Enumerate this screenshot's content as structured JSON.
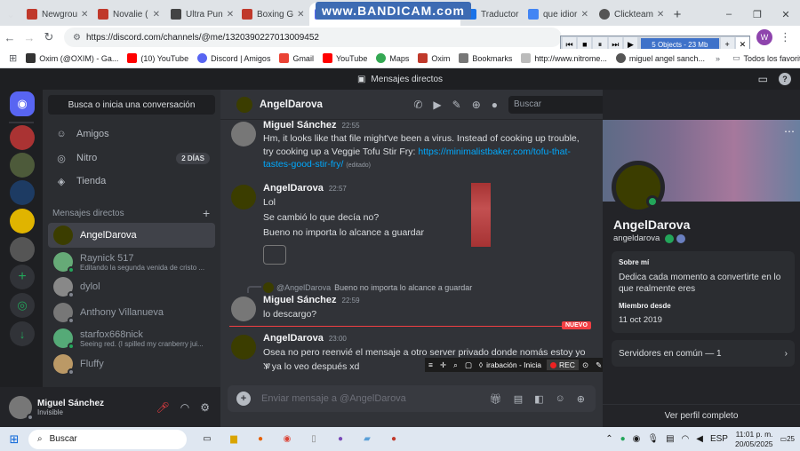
{
  "browser": {
    "tabs": [
      {
        "label": "Newgrou",
        "color": "#c0392b"
      },
      {
        "label": "Novalie (",
        "color": "#c0392b"
      },
      {
        "label": "Ultra Pun",
        "color": "#444"
      },
      {
        "label": "Boxing G",
        "color": "#c0392b"
      },
      {
        "label": "",
        "color": "#5865f2",
        "active": true
      },
      {
        "label": "Traductor",
        "color": "#1a73e8"
      },
      {
        "label": "que idior",
        "color": "#4285f4"
      },
      {
        "label": "Clickteam",
        "color": "#555"
      }
    ],
    "new_tab": "+",
    "url": "https://discord.com/channels/@me/1320390227013009452",
    "profile_initial": "W",
    "bookmarks": [
      {
        "label": "Oxim (@OXIM) - Ga...",
        "color": "#333"
      },
      {
        "label": "(10) YouTube",
        "color": "#ff0000"
      },
      {
        "label": "Discord | Amigos",
        "color": "#5865f2"
      },
      {
        "label": "Gmail",
        "color": "#ea4335"
      },
      {
        "label": "YouTube",
        "color": "#ff0000"
      },
      {
        "label": "Maps",
        "color": "#34a853"
      },
      {
        "label": "Oxim",
        "color": "#c0392b"
      },
      {
        "label": "Bookmarks",
        "color": "#777"
      },
      {
        "label": "http://www.nitrome...",
        "color": "#777"
      },
      {
        "label": "miguel angel sanch...",
        "color": "#555"
      }
    ],
    "all_bookmarks": "Todos los favoritos"
  },
  "bandicam": {
    "watermark": "www.BANDICAM.com",
    "info": "5 Objects - 23 Mb"
  },
  "discord": {
    "window_title": "Mensajes directos",
    "search_conv": "Busca o inicia una conversación",
    "nav": {
      "friends": "Amigos",
      "nitro": "Nitro",
      "nitro_badge": "2 DÍAS",
      "shop": "Tienda"
    },
    "dm_header": "Mensajes directos",
    "dms": [
      {
        "name": "AngelDarova",
        "sub": "",
        "color": "#3b3d00",
        "status": "#23a55a",
        "active": true
      },
      {
        "name": "Raynick 517",
        "sub": "Editando la segunda venida de cristo ...",
        "color": "#6a7",
        "status": "#23a55a"
      },
      {
        "name": "dylol",
        "sub": "",
        "color": "#888",
        "status": "#80848e"
      },
      {
        "name": "Anthony Villanueva",
        "sub": "",
        "color": "#777",
        "status": "#80848e"
      },
      {
        "name": "starfox668nick",
        "sub": "Seeing red. (I spilled my cranberry jui...",
        "color": "#5a7",
        "status": "#23a55a"
      },
      {
        "name": "Fluffy",
        "sub": "",
        "color": "#b96",
        "status": "#80848e"
      }
    ],
    "user": {
      "name": "Miguel Sánchez",
      "status": "Invisible"
    },
    "channel_name": "AngelDarova",
    "header_search": "Buscar",
    "messages": [
      {
        "author": "Miguel Sánchez",
        "time": "22:55",
        "lines": [
          "Hm, it looks like that file might've been a virus. Instead of cooking up trouble,",
          "try cooking up a Veggie Tofu Stir Fry: "
        ],
        "link": "https://minimalistbaker.com/tofu-that-tastes-good-stir-fry/",
        "edited": "(editado)"
      },
      {
        "author": "AngelDarova",
        "time": "22:57",
        "lines": [
          "Lol",
          "Se cambió lo que decía no?",
          "Bueno no importa lo alcance a guardar"
        ]
      },
      {
        "reply_to": "@AngelDarova",
        "reply_text": "Bueno no importa lo alcance a guardar",
        "author": "Miguel Sánchez",
        "time": "22:59",
        "lines": [
          "lo descargo?"
        ]
      },
      {
        "author": "AngelDarova",
        "time": "23:00",
        "lines": [
          "Osea no pero reenvié el mensaje a otro server privado donde nomás estoy yo :v",
          "Y ya lo veo después xd"
        ]
      }
    ],
    "new_label": "NUEVO",
    "composer_placeholder": "Enviar mensaje a @AngelDarova",
    "profile": {
      "display_name": "AngelDarova",
      "username": "angeldarova",
      "about_title": "Sobre mí",
      "about_text": "Dedica cada momento a convertirte en lo que realmente eres",
      "member_title": "Miembro desde",
      "member_date": "11 oct 2019",
      "mutual": "Servidores en común — 1",
      "view_full": "Ver perfil completo"
    },
    "rec_toolbar": {
      "label": "irabación - Inicia",
      "rec": "REC"
    }
  },
  "taskbar": {
    "search": "Buscar",
    "lang": "ESP",
    "time": "11:01 p. m.",
    "date": "20/05/2025",
    "notif": "25"
  }
}
